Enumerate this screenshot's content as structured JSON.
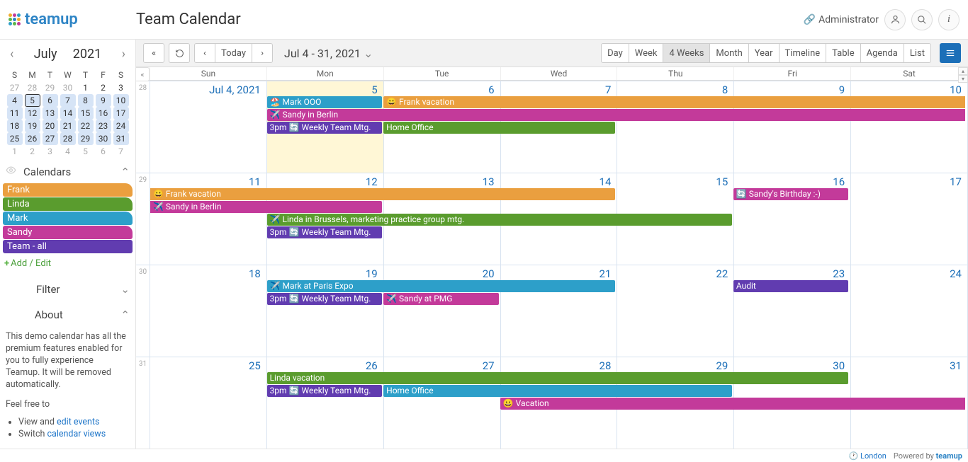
{
  "brand": "teamup",
  "page_title": "Team Calendar",
  "admin": "Administrator",
  "nav": {
    "month": "July",
    "year": "2021"
  },
  "dow": [
    "S",
    "M",
    "T",
    "W",
    "T",
    "F",
    "S"
  ],
  "mini": [
    [
      {
        "d": "27",
        "o": true
      },
      {
        "d": "28",
        "o": true
      },
      {
        "d": "29",
        "o": true
      },
      {
        "d": "30",
        "o": true
      },
      {
        "d": "1"
      },
      {
        "d": "2"
      },
      {
        "d": "3"
      }
    ],
    [
      {
        "d": "4",
        "in": true
      },
      {
        "d": "5",
        "in": true,
        "today": true
      },
      {
        "d": "6",
        "in": true
      },
      {
        "d": "7",
        "in": true
      },
      {
        "d": "8",
        "in": true
      },
      {
        "d": "9",
        "in": true
      },
      {
        "d": "10",
        "in": true
      }
    ],
    [
      {
        "d": "11",
        "in": true
      },
      {
        "d": "12",
        "in": true
      },
      {
        "d": "13",
        "in": true
      },
      {
        "d": "14",
        "in": true
      },
      {
        "d": "15",
        "in": true
      },
      {
        "d": "16",
        "in": true
      },
      {
        "d": "17",
        "in": true
      }
    ],
    [
      {
        "d": "18",
        "in": true
      },
      {
        "d": "19",
        "in": true
      },
      {
        "d": "20",
        "in": true
      },
      {
        "d": "21",
        "in": true
      },
      {
        "d": "22",
        "in": true
      },
      {
        "d": "23",
        "in": true
      },
      {
        "d": "24",
        "in": true
      }
    ],
    [
      {
        "d": "25",
        "in": true
      },
      {
        "d": "26",
        "in": true
      },
      {
        "d": "27",
        "in": true
      },
      {
        "d": "28",
        "in": true
      },
      {
        "d": "29",
        "in": true
      },
      {
        "d": "30",
        "in": true
      },
      {
        "d": "31",
        "in": true
      }
    ],
    [
      {
        "d": "1",
        "o": true
      },
      {
        "d": "2",
        "o": true
      },
      {
        "d": "3",
        "o": true
      },
      {
        "d": "4",
        "o": true
      },
      {
        "d": "5",
        "o": true
      },
      {
        "d": "6",
        "o": true
      },
      {
        "d": "7",
        "o": true
      }
    ]
  ],
  "sections": {
    "calendars": "Calendars",
    "filter": "Filter",
    "about": "About"
  },
  "calendars": [
    {
      "label": "Frank",
      "class": "c-frank"
    },
    {
      "label": "Linda",
      "class": "c-linda"
    },
    {
      "label": "Mark",
      "class": "c-mark"
    },
    {
      "label": "Sandy",
      "class": "c-sandy"
    },
    {
      "label": "Team - all",
      "class": "c-team"
    }
  ],
  "add_edit": "Add / Edit",
  "about_text": "This demo calendar has all the premium features enabled for you to fully experience Teamup. It will be removed automatically.",
  "feel_free": "Feel free to",
  "about_links": {
    "view": "View and ",
    "edit": "edit events",
    "switch": "Switch ",
    "cal_views": "calendar views"
  },
  "toolbar": {
    "today": "Today",
    "range": "Jul 4 - 31, 2021"
  },
  "views": [
    "Day",
    "Week",
    "4 Weeks",
    "Month",
    "Year",
    "Timeline",
    "Table",
    "Agenda",
    "List"
  ],
  "active_view": "4 Weeks",
  "dayhead": [
    "Sun",
    "Mon",
    "Tue",
    "Wed",
    "Thu",
    "Fri",
    "Sat"
  ],
  "weeks": [
    {
      "no": "28",
      "days": [
        "Jul 4, 2021",
        "5",
        "6",
        "7",
        "8",
        "9",
        "10"
      ],
      "today": 1
    },
    {
      "no": "29",
      "days": [
        "11",
        "12",
        "13",
        "14",
        "15",
        "16",
        "17"
      ]
    },
    {
      "no": "30",
      "days": [
        "18",
        "19",
        "20",
        "21",
        "22",
        "23",
        "24"
      ]
    },
    {
      "no": "31",
      "days": [
        "25",
        "26",
        "27",
        "28",
        "29",
        "30",
        "31"
      ]
    }
  ],
  "ev": {
    "mark_ooo": "Mark OOO",
    "frank_vac": "Frank vacation",
    "sandy_berlin": "Sandy in Berlin",
    "weekly": "Weekly Team Mtg.",
    "home_office": "Home Office",
    "linda_brussels": "Linda in Brussels, marketing practice group mtg.",
    "sandy_bday": "Sandy's Birthday :-)",
    "mark_paris": "Mark at Paris Expo",
    "sandy_pmg": "Sandy at PMG",
    "audit": "Audit",
    "linda_vac": "Linda vacation",
    "vacation": "Vacation",
    "time_3pm": "3pm"
  },
  "footer": {
    "tz": "London",
    "powered": "Powered by",
    "brand": "teamup"
  }
}
